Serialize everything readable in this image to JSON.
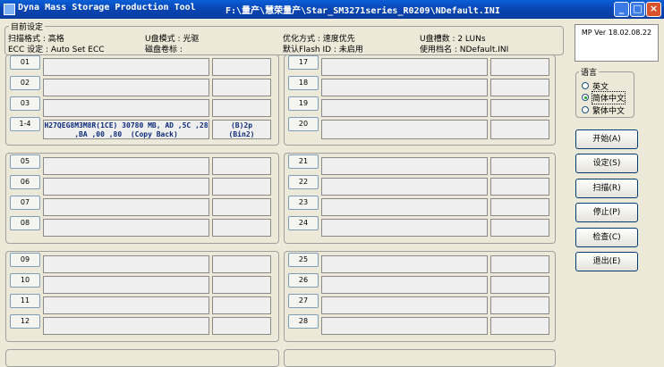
{
  "window": {
    "title": "Dyna Mass Storage Production Tool",
    "path": "F:\\量产\\慧荣量产\\Star_SM3271series_R0209\\NDefault.INI"
  },
  "settings": {
    "legend": "目前设定",
    "scan_format": "扫描格式 : 高格",
    "ecc": "ECC 设定 : Auto Set ECC",
    "u_mode": "U盘模式 : 光驱",
    "disk_label": "磁盘卷标 :",
    "optimize": "优化方式 : 速度优先",
    "flash_id": "默认Flash ID : 未启用",
    "lun_count": "U盘槽数 : 2 LUNs",
    "file_name": "使用档名 : NDefault.INI"
  },
  "ports": {
    "p01": "01",
    "p02": "02",
    "p03": "03",
    "p14": "1-4",
    "p05": "05",
    "p06": "06",
    "p07": "07",
    "p08": "08",
    "p09": "09",
    "p10": "10",
    "p11": "11",
    "p12": "12",
    "p17": "17",
    "p18": "18",
    "p19": "19",
    "p20": "20",
    "p21": "21",
    "p22": "22",
    "p23": "23",
    "p24": "24",
    "p25": "25",
    "p26": "26",
    "p27": "27",
    "p28": "28"
  },
  "device": {
    "status_line1": "H27QEG8M3M8R(1CE) 30780 MB, AD ,5C ,28",
    "status_line2": ",BA ,00 ,80  (Copy Back)",
    "cap_line1": "(B)2p",
    "cap_line2": "(Bin2)"
  },
  "side": {
    "version": "MP Ver 18.02.08.22",
    "language_legend": "语言",
    "lang_en": "英文",
    "lang_sc": "简体中文",
    "lang_tc": "繁体中文",
    "selected_language": "简体中文",
    "start": "开始(A)",
    "setup": "设定(S)",
    "scan": "扫描(R)",
    "stop": "停止(P)",
    "check": "检查(C)",
    "exit": "退出(E)"
  },
  "colors": {
    "titlebar": "#0A4CC0",
    "face": "#ECE9D8",
    "status_text": "#0B2A7A"
  }
}
